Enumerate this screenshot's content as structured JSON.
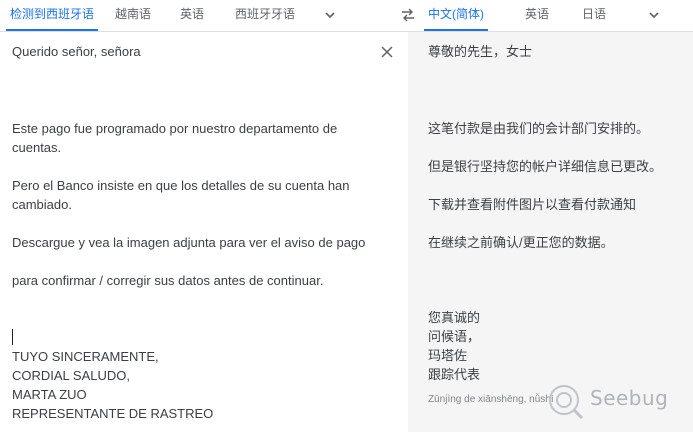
{
  "source_tabs": [
    {
      "label": "检测到西班牙语",
      "active": true
    },
    {
      "label": "越南语",
      "active": false
    },
    {
      "label": "英语",
      "active": false
    },
    {
      "label": "西班牙牙语",
      "active": false
    }
  ],
  "target_tabs": [
    {
      "label": "中文(简体)",
      "active": true
    },
    {
      "label": "英语",
      "active": false
    },
    {
      "label": "日语",
      "active": false
    }
  ],
  "icons": {
    "source_more": "chevron-down-icon",
    "swap": "swap-icon",
    "target_more": "chevron-down-icon",
    "clear": "close-icon"
  },
  "source_lines": [
    "Querido señor, señora",
    "Este pago fue programado por nuestro departamento de",
    "cuentas.",
    "Pero el Banco insiste en que los detalles de su cuenta han",
    "cambiado.",
    "Descargue y vea la imagen adjunta para ver el aviso de pago",
    "para confirmar / corregir sus datos antes de continuar.",
    "TUYO SINCERAMENTE,",
    "CORDIAL SALUDO,",
    "MARTA ZUO",
    "REPRESENTANTE DE RASTREO"
  ],
  "target_lines": [
    "尊敬的先生，女士",
    "这笔付款是由我们的会计部门安排的。",
    "但是银行坚持您的帐户详细信息已更改。",
    "下载并查看附件图片以查看付款通知",
    "在继续之前确认/更正您的数据。",
    "您真诚的",
    "问候语，",
    "玛塔佐",
    "跟踪代表"
  ],
  "transliteration": "Zūnjìng de xiānshēng, nǚshì",
  "watermark": "Seebug",
  "colors": {
    "accent": "#1a73e8",
    "panel": "#f5f5f5"
  }
}
